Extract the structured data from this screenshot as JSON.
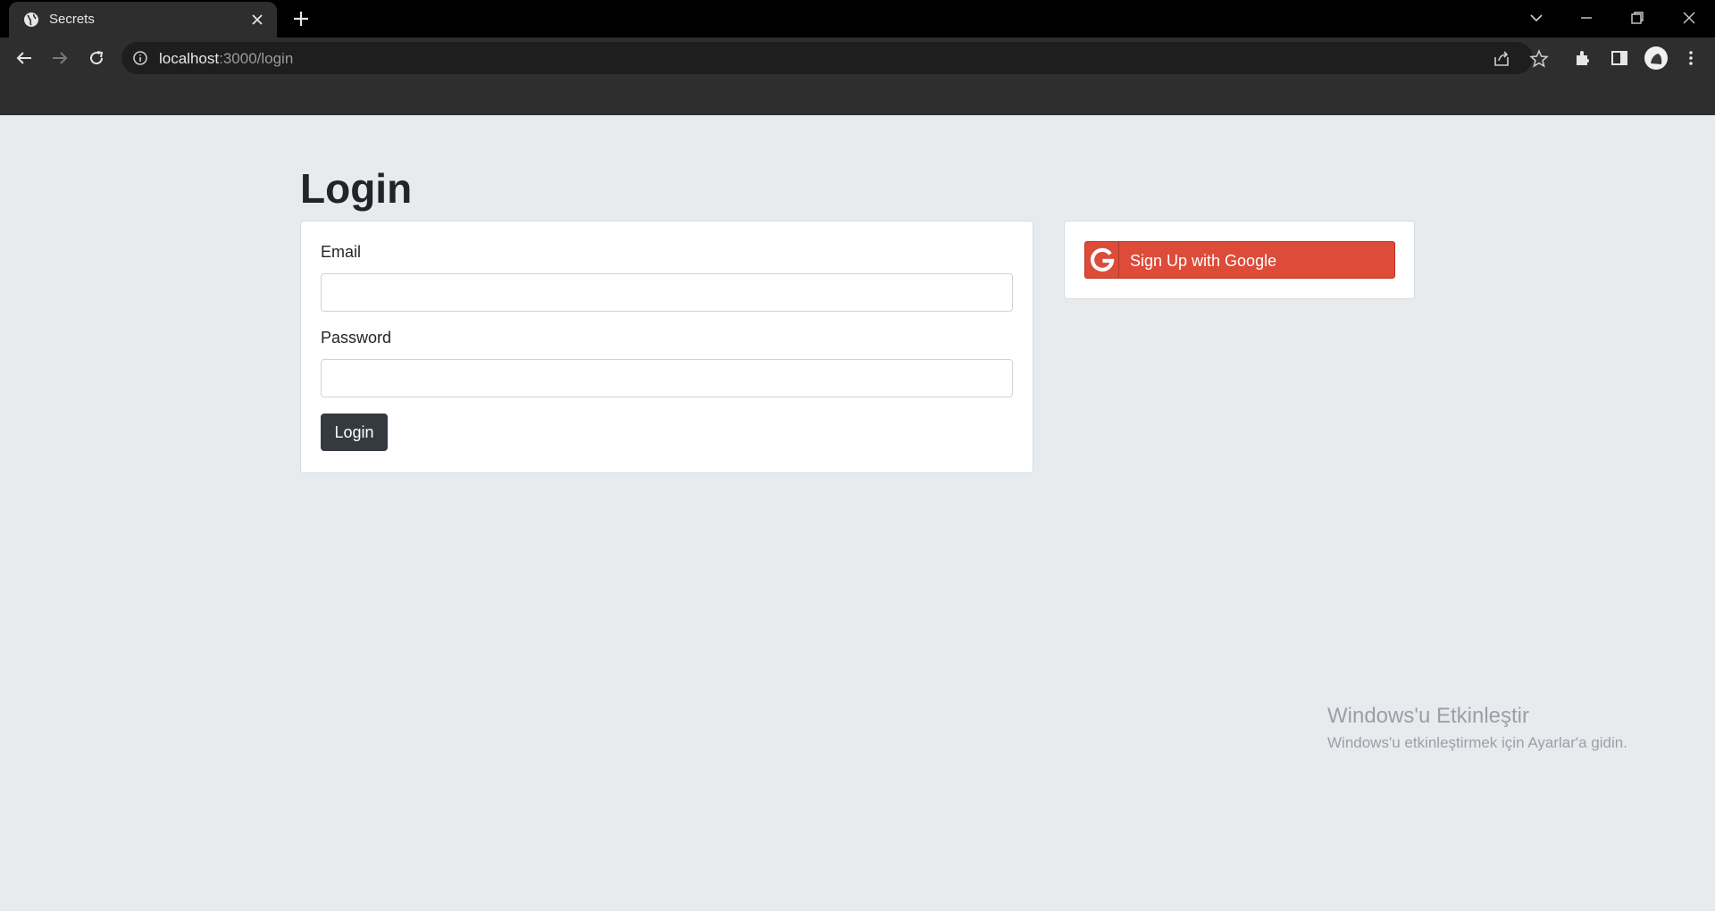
{
  "browser": {
    "tab": {
      "title": "Secrets",
      "favicon": "globe-icon"
    },
    "omnibox": {
      "host": "localhost",
      "path": ":3000/login"
    }
  },
  "page": {
    "heading": "Login",
    "login_form": {
      "email_label": "Email",
      "email_value": "",
      "password_label": "Password",
      "password_value": "",
      "submit_label": "Login"
    },
    "social": {
      "google_label": "Sign Up with Google"
    },
    "colors": {
      "google": "#dd4b39",
      "login_button": "#343a40",
      "page_bg": "#e8ebee"
    }
  },
  "watermark": {
    "title": "Windows'u Etkinleştir",
    "subtitle": "Windows'u etkinleştirmek için Ayarlar'a gidin."
  }
}
